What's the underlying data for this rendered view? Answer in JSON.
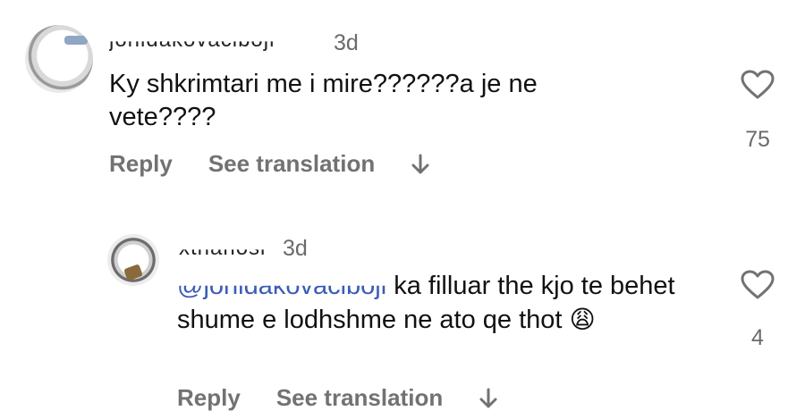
{
  "comments": [
    {
      "username": "jonidakovaciboji",
      "time": "3d",
      "text": "Ky shkrimtari me i mire??????a je ne vete????",
      "likes": "75",
      "reply_label": "Reply",
      "translate_label": "See translation"
    },
    {
      "username": "xthanosi",
      "time": "3d",
      "mention": "@jonidakovaciboji",
      "text": "ka filluar the kjo te behet shume e lodhshme ne ato qe thot",
      "emoji": "😩",
      "likes": "4",
      "reply_label": "Reply",
      "translate_label": "See translation"
    }
  ],
  "colors": {
    "text": "#111111",
    "secondary": "#727272",
    "mention": "#3a5bb8"
  },
  "icons": [
    "heart-icon",
    "arrow-down-icon"
  ]
}
